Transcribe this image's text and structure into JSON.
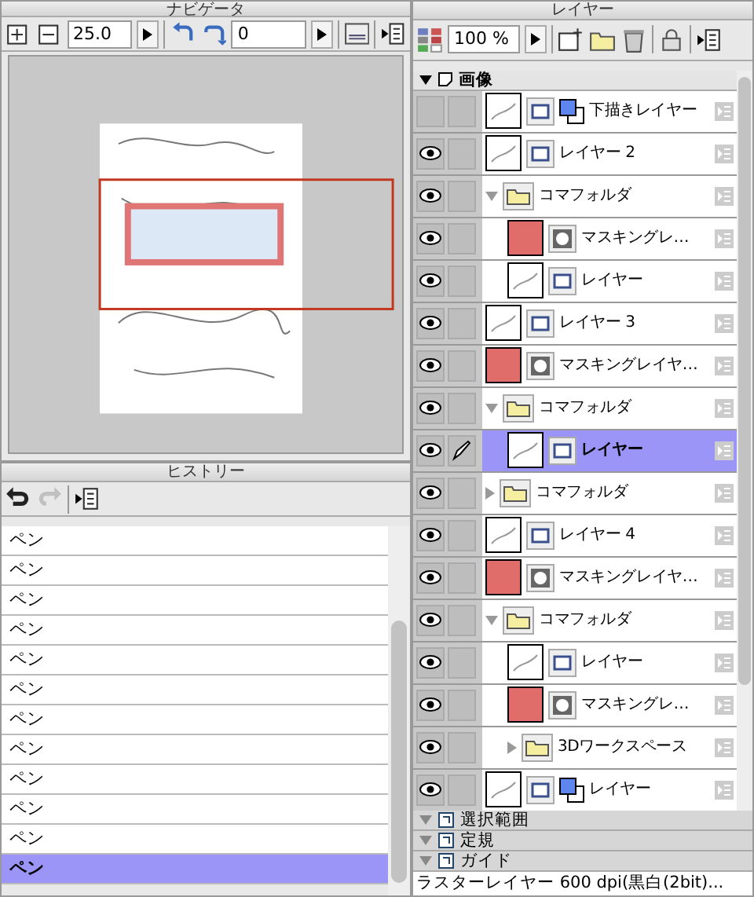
{
  "navigator": {
    "title": "ナビゲータ",
    "zoom": "25.0",
    "angle": "0"
  },
  "history": {
    "title": "ヒストリー",
    "items": [
      {
        "label": "ペン",
        "selected": false
      },
      {
        "label": "ペン",
        "selected": false
      },
      {
        "label": "ペン",
        "selected": false
      },
      {
        "label": "ペン",
        "selected": false
      },
      {
        "label": "ペン",
        "selected": false
      },
      {
        "label": "ペン",
        "selected": false
      },
      {
        "label": "ペン",
        "selected": false
      },
      {
        "label": "ペン",
        "selected": false
      },
      {
        "label": "ペン",
        "selected": false
      },
      {
        "label": "ペン",
        "selected": false
      },
      {
        "label": "ペン",
        "selected": false
      },
      {
        "label": "ペン",
        "selected": true
      }
    ]
  },
  "layers": {
    "title": "レイヤー",
    "opacity": "100 %",
    "group": "画像",
    "items": [
      {
        "kind": "layer",
        "name": "下描きレイヤー",
        "visible": false,
        "selected": false,
        "color_mode": true
      },
      {
        "kind": "layer",
        "name": "レイヤー 2",
        "visible": true,
        "selected": false
      },
      {
        "kind": "folder",
        "name": "コマフォルダ",
        "visible": true,
        "selected": false,
        "expanded": true,
        "children": [
          {
            "kind": "mask",
            "name": "マスキングレ…",
            "visible": true,
            "selected": false
          },
          {
            "kind": "layer",
            "name": "レイヤー",
            "visible": true,
            "selected": false
          }
        ]
      },
      {
        "kind": "layer",
        "name": "レイヤー 3",
        "visible": true,
        "selected": false
      },
      {
        "kind": "mask",
        "name": "マスキングレイヤ…",
        "visible": true,
        "selected": false
      },
      {
        "kind": "folder",
        "name": "コマフォルダ",
        "visible": true,
        "selected": false,
        "expanded": true,
        "children": [
          {
            "kind": "layer",
            "name": "レイヤー",
            "visible": true,
            "selected": true,
            "editing": true
          }
        ]
      },
      {
        "kind": "folder",
        "name": "コマフォルダ",
        "visible": true,
        "selected": false,
        "expanded": false
      },
      {
        "kind": "layer",
        "name": "レイヤー 4",
        "visible": true,
        "selected": false
      },
      {
        "kind": "mask",
        "name": "マスキングレイヤ…",
        "visible": true,
        "selected": false
      },
      {
        "kind": "folder",
        "name": "コマフォルダ",
        "visible": true,
        "selected": false,
        "expanded": true,
        "children": [
          {
            "kind": "layer",
            "name": "レイヤー",
            "visible": true,
            "selected": false
          },
          {
            "kind": "mask",
            "name": "マスキングレ…",
            "visible": true,
            "selected": false
          },
          {
            "kind": "folder",
            "name": "3Dワークスペース",
            "visible": true,
            "selected": false,
            "expanded": false
          }
        ]
      },
      {
        "kind": "layer",
        "name": "レイヤー",
        "visible": true,
        "selected": false,
        "color_mode": true
      }
    ],
    "sections": [
      "選択範囲",
      "定規",
      "ガイド"
    ],
    "status": "ラスターレイヤー 600 dpi(黒白(2bit)..."
  }
}
